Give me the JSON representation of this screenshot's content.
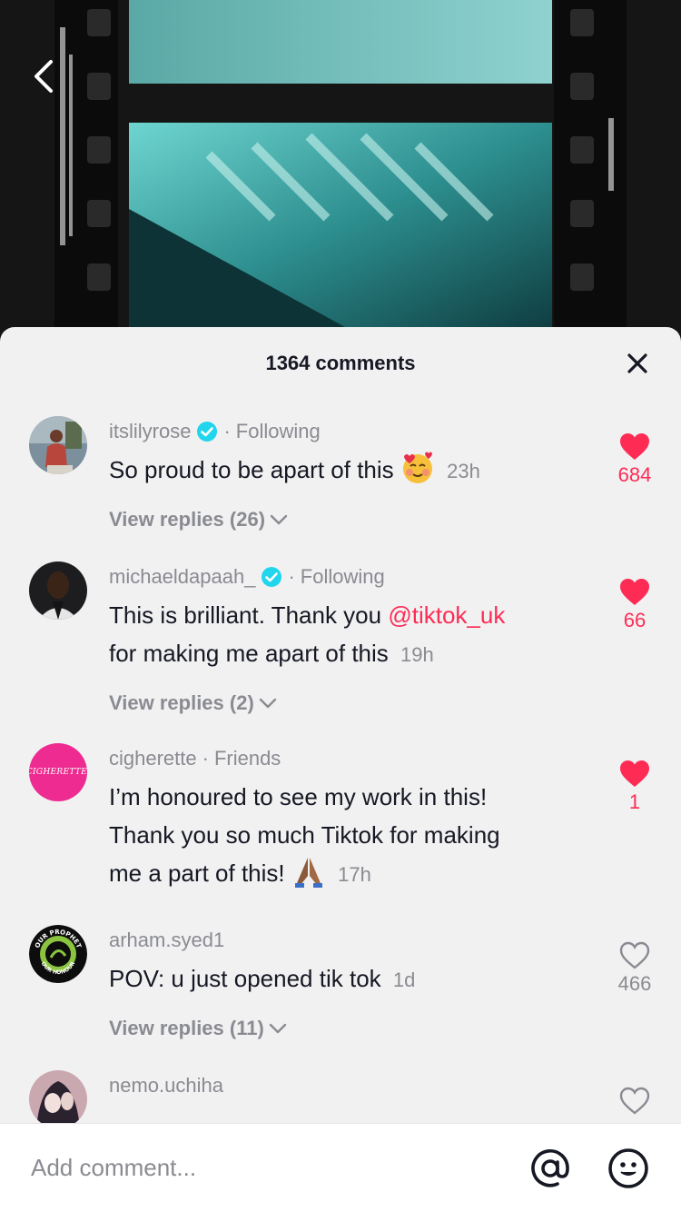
{
  "sheet": {
    "title": "1364 comments"
  },
  "comments": [
    {
      "username": "itslilyrose",
      "verified": true,
      "relation": "Following",
      "text": "So proud to be apart of this",
      "time": "23h",
      "replies_label": "View replies (26)",
      "likes": "684",
      "liked": true
    },
    {
      "username": "michaeldapaah_",
      "verified": true,
      "relation": "Following",
      "text_before": "This is brilliant. Thank you",
      "mention": "@tiktok_uk",
      "text_after": "for making me apart of this",
      "time": "19h",
      "replies_label": "View replies (2)",
      "likes": "66",
      "liked": true
    },
    {
      "username": "cigherette",
      "avatar_text": "CIGHERETTE.",
      "verified": false,
      "relation": "Friends",
      "text_line1": "I’m honoured to see my work in this!",
      "text_line2": "Thank you so much Tiktok for making",
      "text_line3": "me a part of this!",
      "time": "17h",
      "likes": "1",
      "liked": true
    },
    {
      "username": "arham.syed1",
      "avatar_text_top": "OUR PROPHET",
      "avatar_text_bottom": "OUR HONOUR",
      "verified": false,
      "text": "POV: u just opened tik tok",
      "time": "1d",
      "replies_label": "View replies (11)",
      "likes": "466",
      "liked": false
    },
    {
      "username": "nemo.uchiha",
      "verified": false,
      "liked": false
    }
  ],
  "input": {
    "placeholder": "Add comment..."
  },
  "colors": {
    "accent": "#fe2c55",
    "verified": "#20d5ec",
    "muted": "#8a8b91",
    "text": "#161823"
  },
  "icons": [
    "back-arrow-icon",
    "close-icon",
    "verified-badge-icon",
    "heart-filled-icon",
    "heart-outline-icon",
    "chevron-down-icon",
    "at-sign-icon",
    "emoji-icon"
  ]
}
